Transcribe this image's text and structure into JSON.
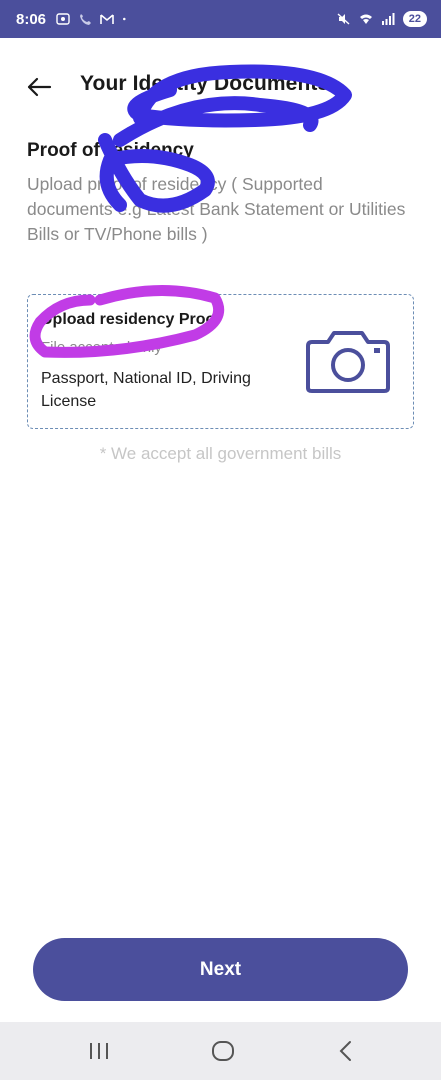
{
  "status_bar": {
    "time": "8:06",
    "battery": "22"
  },
  "header": {
    "title": "Your Identity Documents",
    "back_icon": "arrow-left-icon"
  },
  "section": {
    "title": "Proof of residency",
    "description": "Upload proof of residency ( Supported documents e.g Latest Bank Statement or Utilities Bills or TV/Phone bills )"
  },
  "upload_card": {
    "title": "Upload residency Proof",
    "formats": "File accepted only",
    "documents": "Passport, National ID, Driving License",
    "icon": "camera-icon"
  },
  "note": "* We accept all government bills",
  "next_label": "Next",
  "colors": {
    "primary": "#4b4f9c",
    "muted_text": "#8a8a8a",
    "dashed_border": "#6c8db5",
    "scribble_blue": "#3a2fe0",
    "scribble_purple": "#c13ce6"
  }
}
